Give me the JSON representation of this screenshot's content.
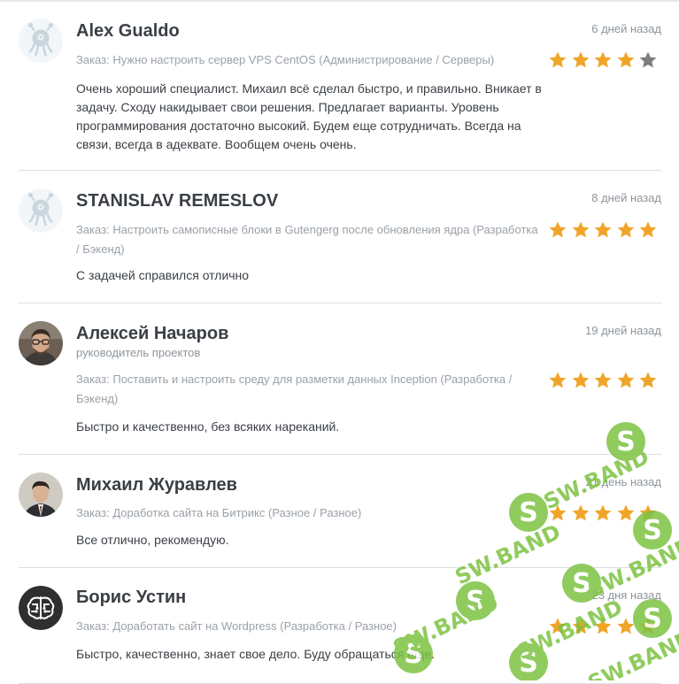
{
  "order_prefix": "Заказ:",
  "rating_max": 5,
  "colors": {
    "star_on": "#f0a529",
    "star_off": "#7d7d7d",
    "divider": "#dcdfe3",
    "muted": "#9aa1a8",
    "name": "#3a3f45"
  },
  "reviews": [
    {
      "name": "Alex Gualdo",
      "role": "",
      "date": "6 дней назад",
      "order": "Нужно настроить сервер VPS CentOS (Администрирование / Серверы)",
      "rating": 4,
      "text": "Очень хороший специалист. Михаил всё сделал быстро, и правильно. Вникает в задачу. Сходу накидывает свои решения. Предлагает варианты. Уровень программирования достаточно высокий. Будем еще сотрудничать. Всегда на связи, всегда в адеквате. Вообщем очень очень.",
      "avatar_icon": "default-robot-avatar"
    },
    {
      "name": "STANISLAV REMESLOV",
      "role": "",
      "date": "8 дней назад",
      "order": "Настроить самописные блоки в Gutengerg после обновления ядра (Разработка / Бэкенд)",
      "rating": 5,
      "text": "С задачей справился отлично",
      "avatar_icon": "default-robot-avatar"
    },
    {
      "name": "Алексей Начаров",
      "role": "руководитель проектов",
      "date": "19 дней назад",
      "order": "Поставить и настроить среду для разметки данных Inception (Разработка / Бэкенд)",
      "rating": 5,
      "text": "Быстро и качественно, без всяких нареканий.",
      "avatar_icon": "user-photo-glasses"
    },
    {
      "name": "Михаил Журавлев",
      "role": "",
      "date": "21 день назад",
      "order": "Доработка сайта на Битрикс (Разное / Разное)",
      "rating": 5,
      "text": "Все отлично, рекомендую.",
      "avatar_icon": "user-photo-suit"
    },
    {
      "name": "Борис Устин",
      "role": "",
      "date": "23 дня назад",
      "order": "Доработать сайт на Wordpress (Разработка / Разное)",
      "rating": 5,
      "text": "Быстро, качественно, знает свое дело. Буду обращаться еще.",
      "avatar_icon": "brain-logo-avatar"
    }
  ],
  "watermark": {
    "text": "SW.BAND",
    "letter": "S",
    "color": "#7dc242"
  }
}
